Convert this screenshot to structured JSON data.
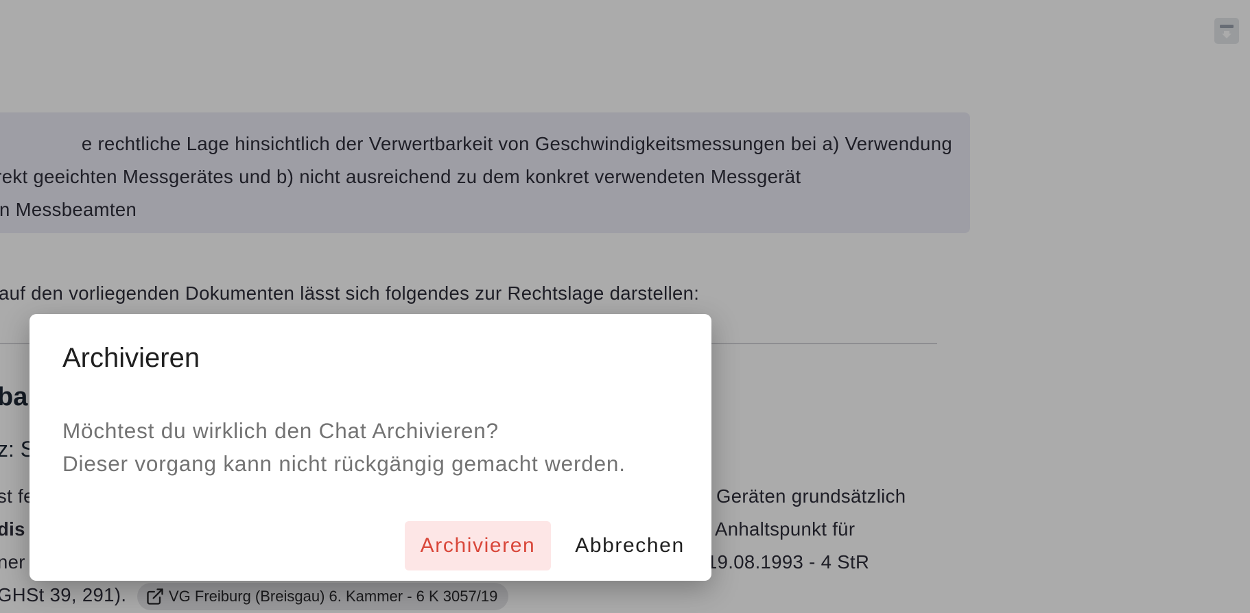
{
  "top_bar": {
    "archive_icon": "archive-download-icon"
  },
  "conversation": {
    "user_message": {
      "line1": "e rechtliche Lage hinsichtlich der Verwertbarkeit von Geschwindigkeitsmessungen bei a) Verwendung",
      "line2": "t korrekt geeichten Messgerätes und b) nicht ausreichend zu dem konkret verwendeten Messgerät",
      "line3": "n Messbeamten"
    },
    "answer": {
      "intro": "auf den vorliegenden Dokumenten lässt sich folgendes zur Rechtslage darstellen:",
      "heading_fragment": "ba",
      "subheading_fragment": "z: S",
      "line1_left": "st fe",
      "line1_right": "Geräten grundsätzlich",
      "line2_left": "dis",
      "line2_right": "Anhaltspunkt für",
      "line3_left": "ner",
      "line3_right": "19.08.1993 - 4 StR",
      "line4_left": "GHSt 39, 291).",
      "citation": {
        "icon": "external-link-icon",
        "label": "VG Freiburg (Breisgau) 6. Kammer - 6 K 3057/19"
      }
    }
  },
  "dialog": {
    "title": "Archivieren",
    "message_line1": "Möchtest du wirklich den Chat Archivieren?",
    "message_line2": "Dieser vorgang kann nicht rückgängig gemacht werden.",
    "confirm_label": "Archivieren",
    "cancel_label": "Abbrechen"
  },
  "colors": {
    "overlay": "rgba(0,0,0,0.33)",
    "confirm_text": "#d9473a",
    "confirm_bg": "#fde6e6",
    "user_bubble": "#ececf7"
  }
}
